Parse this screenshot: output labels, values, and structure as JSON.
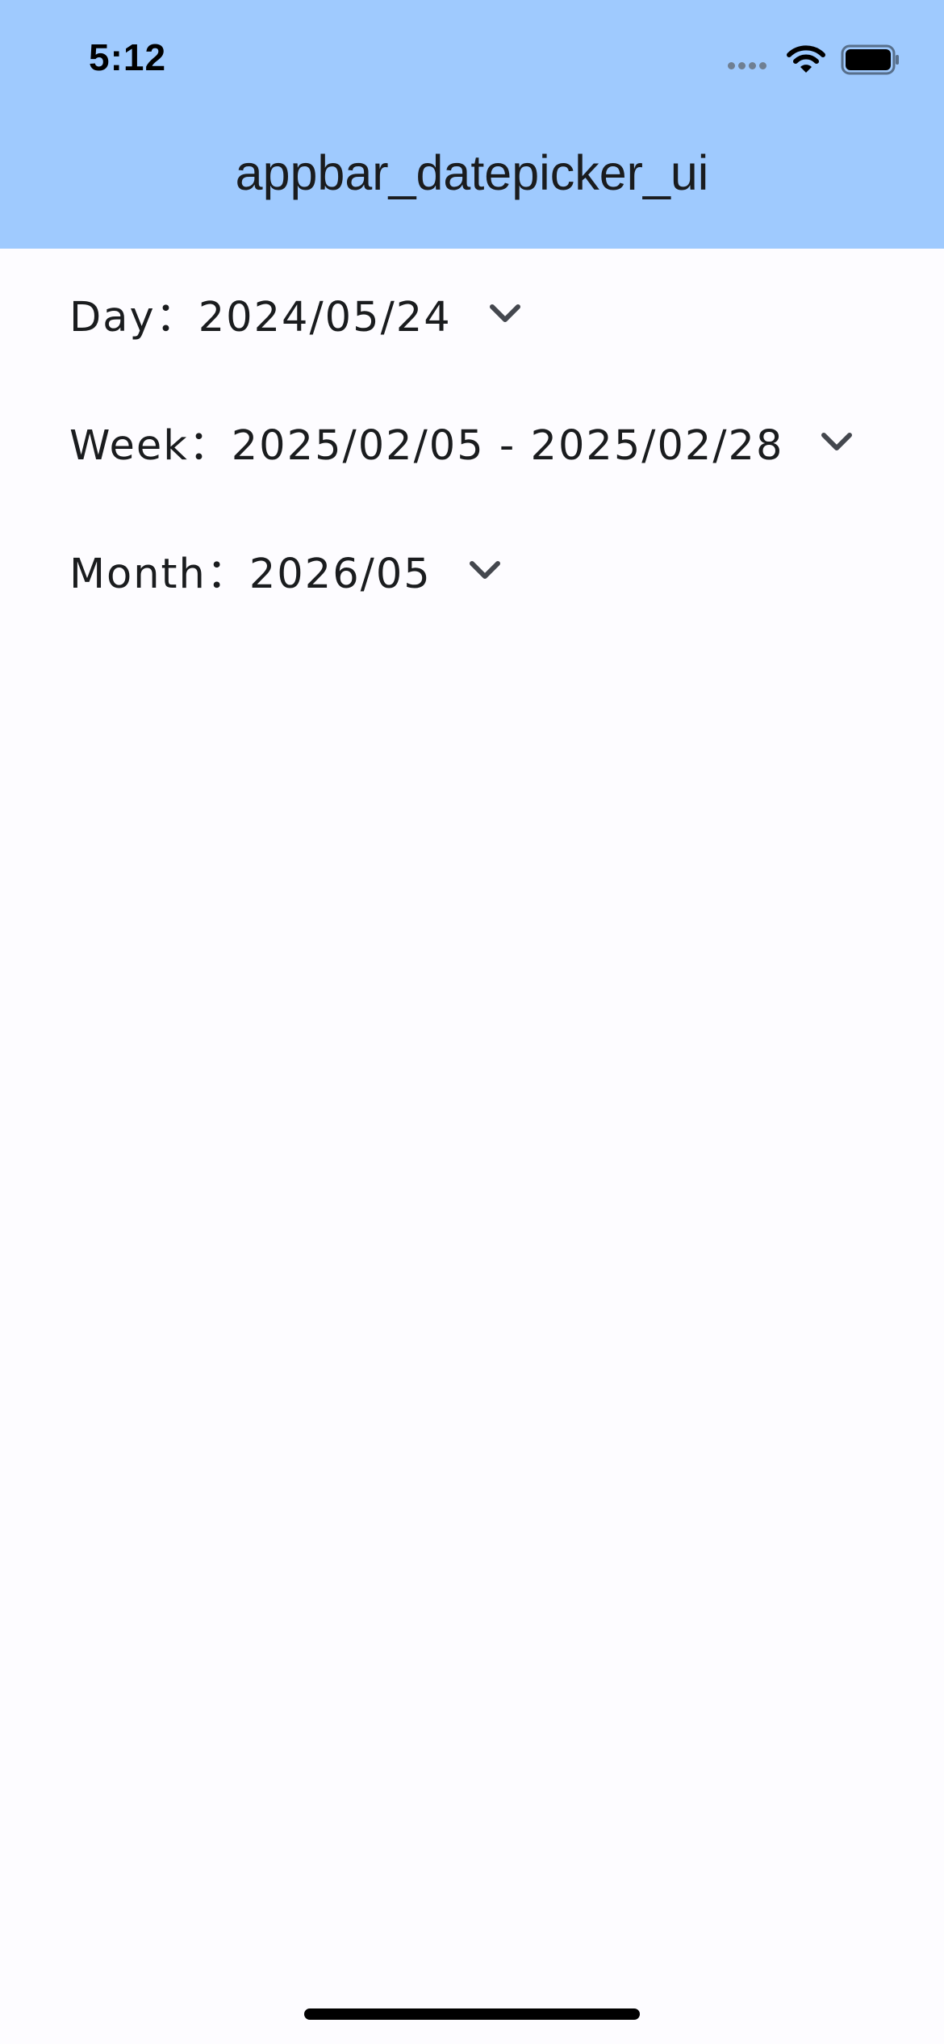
{
  "status_bar": {
    "time": "5:12",
    "icons": [
      "signal-icon",
      "wifi-icon",
      "battery-icon"
    ]
  },
  "app_bar": {
    "title": "appbar_datepicker_ui",
    "background": "#9fcafe"
  },
  "pickers": [
    {
      "label": "Day：2024/05/24",
      "icon": "chevron-down-icon"
    },
    {
      "label": "Week：2025/02/05 - 2025/02/28",
      "icon": "chevron-down-icon"
    },
    {
      "label": "Month：2026/05",
      "icon": "chevron-down-icon"
    }
  ],
  "colors": {
    "text": "#1a1c1e",
    "icon": "#44474e",
    "page_background": "#fdfcff"
  }
}
